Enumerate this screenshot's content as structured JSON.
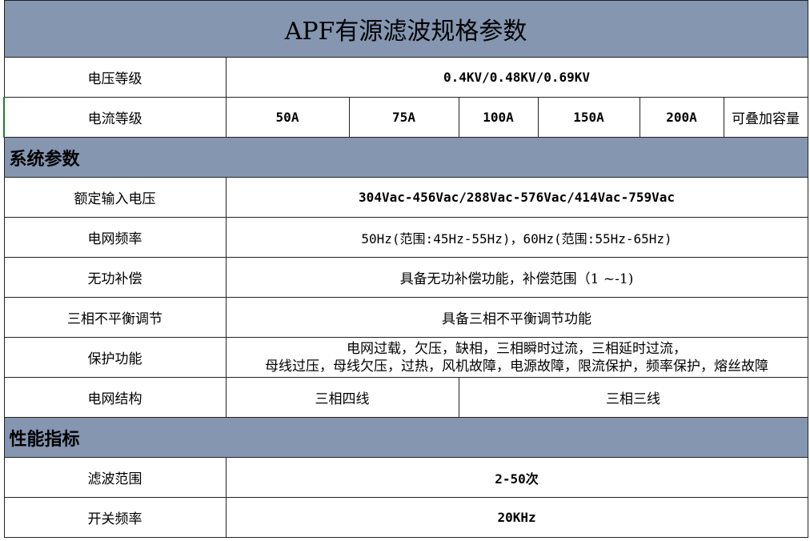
{
  "title": "APF有源滤波规格参数",
  "voltage_level": {
    "label": "电压等级",
    "value": "0.4KV/0.48KV/0.69KV"
  },
  "current_level": {
    "label": "电流等级",
    "options": [
      "50A",
      "75A",
      "100A",
      "150A",
      "200A",
      "可叠加容量"
    ]
  },
  "section_system": "系统参数",
  "rated_input_voltage": {
    "label": "额定输入电压",
    "value": "304Vac-456Vac/288Vac-576Vac/414Vac-759Vac"
  },
  "grid_frequency": {
    "label": "电网频率",
    "value": "50Hz(范围:45Hz-55Hz)，60Hz(范围:55Hz-65Hz)"
  },
  "reactive_compensation": {
    "label": "无功补偿",
    "value": "具备无功补偿功能，补偿范围（1 ~-1)"
  },
  "three_phase_balance": {
    "label": "三相不平衡调节",
    "value": "具备三相不平衡调节功能"
  },
  "protection": {
    "label": "保护功能",
    "line1": "电网过载，欠压，缺相，三相瞬时过流，三相延时过流，",
    "line2": "母线过压，母线欠压，过热，风机故障，电源故障，限流保护，频率保护，熔丝故障"
  },
  "grid_structure": {
    "label": "电网结构",
    "options": [
      "三相四线",
      "三相三线"
    ]
  },
  "section_performance": "性能指标",
  "filter_range": {
    "label": "滤波范围",
    "value": "2-50次"
  },
  "switching_frequency": {
    "label": "开关频率",
    "value": "20KHz"
  }
}
